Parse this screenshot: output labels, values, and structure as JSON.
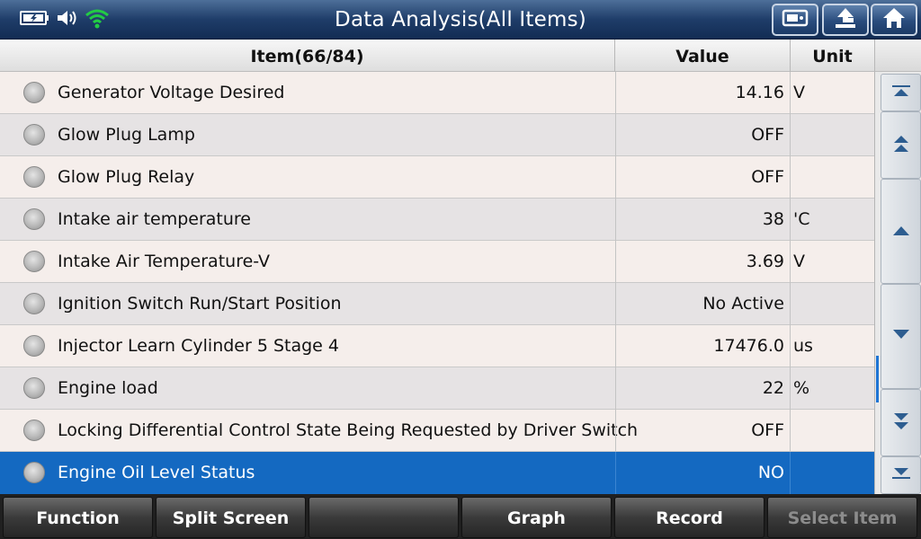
{
  "header": {
    "title": "Data Analysis(All Items)",
    "buttons": [
      {
        "name": "screenshot-icon"
      },
      {
        "name": "back-arrow-icon"
      },
      {
        "name": "home-icon"
      }
    ],
    "status_icons": [
      "battery-charging-icon",
      "speaker-icon",
      "wifi-icon"
    ]
  },
  "table": {
    "columns": {
      "item": "Item(66/84)",
      "value": "Value",
      "unit": "Unit"
    },
    "rows": [
      {
        "item": "Generator Voltage Desired",
        "value": "14.16",
        "unit": "V"
      },
      {
        "item": "Glow Plug Lamp",
        "value": "OFF",
        "unit": ""
      },
      {
        "item": "Glow Plug Relay",
        "value": "OFF",
        "unit": ""
      },
      {
        "item": "Intake air temperature",
        "value": "38",
        "unit": "'C"
      },
      {
        "item": "Intake Air Temperature-V",
        "value": "3.69",
        "unit": "V"
      },
      {
        "item": "Ignition Switch Run/Start Position",
        "value": "No Active",
        "unit": ""
      },
      {
        "item": "Injector Learn Cylinder 5 Stage 4",
        "value": "17476.0",
        "unit": "us"
      },
      {
        "item": "Engine load",
        "value": "22",
        "unit": "%"
      },
      {
        "item": "Locking Differential Control State Being Requested by Driver Switch",
        "value": "OFF",
        "unit": ""
      },
      {
        "item": "Engine Oil Level Status",
        "value": "NO",
        "unit": ""
      }
    ],
    "selected_index": 9
  },
  "scrollbar": {
    "buttons": [
      "scroll-top-icon",
      "page-up-icon",
      "scroll-up-icon",
      "scroll-down-icon",
      "page-down-icon",
      "scroll-bottom-icon"
    ]
  },
  "toolbar": {
    "buttons": [
      {
        "label": "Function",
        "enabled": true
      },
      {
        "label": "Split Screen",
        "enabled": true
      },
      {
        "label": "",
        "enabled": true
      },
      {
        "label": "Graph",
        "enabled": true
      },
      {
        "label": "Record",
        "enabled": true
      },
      {
        "label": "Select Item",
        "enabled": false
      }
    ]
  },
  "colors": {
    "selection": "#1469c1",
    "header_bg": "#1f3d69",
    "wifi": "#22cc44"
  }
}
